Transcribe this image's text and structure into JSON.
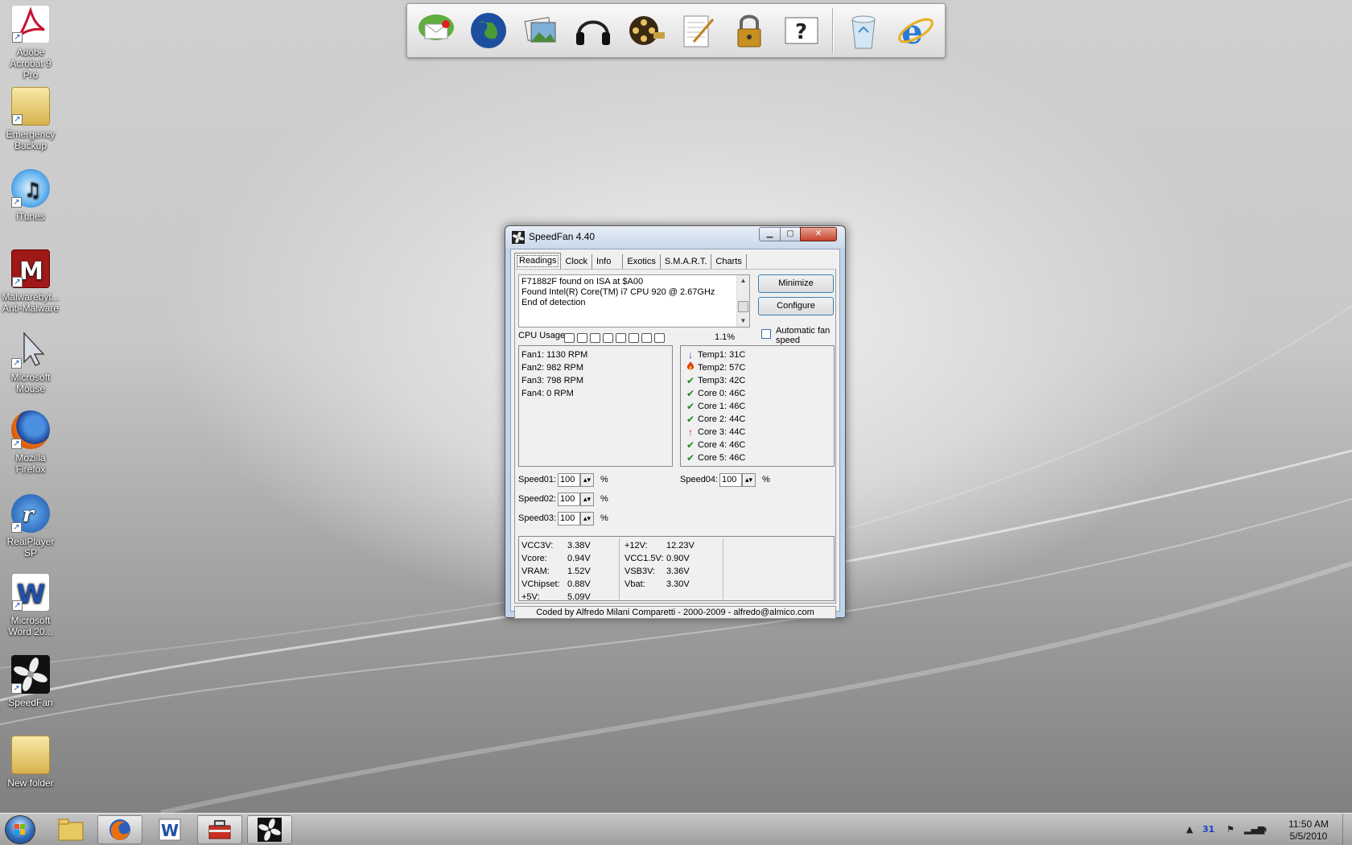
{
  "desktop_icons": [
    {
      "label": "Adobe Acrobat 9 Pro",
      "icon": "adobe-acrobat-icon"
    },
    {
      "label": "Emergency Backup",
      "icon": "folder-icon"
    },
    {
      "label": "iTunes",
      "icon": "itunes-icon"
    },
    {
      "label": "Malwarebyt... Anti-Malware",
      "icon": "malwarebytes-icon"
    },
    {
      "label": "Microsoft Mouse",
      "icon": "mouse-pointer-icon"
    },
    {
      "label": "Mozilla Firefox",
      "icon": "firefox-icon"
    },
    {
      "label": "RealPlayer SP",
      "icon": "realplayer-icon"
    },
    {
      "label": "Microsoft Word 20...",
      "icon": "word-icon"
    },
    {
      "label": "SpeedFan",
      "icon": "speedfan-icon"
    },
    {
      "label": "New folder",
      "icon": "folder-icon"
    }
  ],
  "dock": [
    "mail-icon",
    "globe-icon",
    "photos-icon",
    "headphones-icon",
    "film-reel-icon",
    "notes-icon",
    "lock-icon",
    "help-icon",
    "recycle-bin-icon",
    "internet-explorer-icon"
  ],
  "window": {
    "title": "SpeedFan 4.40",
    "tabs": [
      "Readings",
      "Clock",
      "Info",
      "Exotics",
      "S.M.A.R.T.",
      "Charts"
    ],
    "log": [
      "F71882F found on ISA at $A00",
      "Found Intel(R) Core(TM) i7 CPU 920 @ 2.67GHz",
      "End of detection"
    ],
    "minimize_label": "Minimize",
    "configure_label": "Configure",
    "auto_fan_label": "Automatic fan speed",
    "auto_fan_checked": false,
    "cpu_usage_label": "CPU Usage",
    "cpu_usage_value": "1.1%",
    "fans": [
      "Fan1: 1130 RPM",
      "Fan2: 982 RPM",
      "Fan3: 798 RPM",
      "Fan4: 0 RPM"
    ],
    "temps": [
      {
        "label": "Temp1:",
        "value": "31C",
        "status": "down-arrow-icon",
        "color": "#1a3fd0"
      },
      {
        "label": "Temp2:",
        "value": "57C",
        "status": "flame-icon",
        "color": "#e04010"
      },
      {
        "label": "Temp3:",
        "value": "42C",
        "status": "checkmark-icon",
        "color": "#1c8a1c"
      },
      {
        "label": "Core 0:",
        "value": "46C",
        "status": "checkmark-icon",
        "color": "#1c8a1c"
      },
      {
        "label": "Core 1:",
        "value": "46C",
        "status": "checkmark-icon",
        "color": "#1c8a1c"
      },
      {
        "label": "Core 2:",
        "value": "44C",
        "status": "checkmark-icon",
        "color": "#1c8a1c"
      },
      {
        "label": "Core 3:",
        "value": "44C",
        "status": "up-arrow-icon",
        "color": "#d01010"
      },
      {
        "label": "Core 4:",
        "value": "46C",
        "status": "checkmark-icon",
        "color": "#1c8a1c"
      },
      {
        "label": "Core 5:",
        "value": "46C",
        "status": "checkmark-icon",
        "color": "#1c8a1c"
      }
    ],
    "speeds": [
      {
        "label": "Speed01:",
        "value": "100",
        "unit": "%"
      },
      {
        "label": "Speed02:",
        "value": "100",
        "unit": "%"
      },
      {
        "label": "Speed03:",
        "value": "100",
        "unit": "%"
      },
      {
        "label": "Speed04:",
        "value": "100",
        "unit": "%"
      }
    ],
    "voltages_left": [
      {
        "label": "VCC3V:",
        "value": "3.38V"
      },
      {
        "label": "Vcore:",
        "value": "0.94V"
      },
      {
        "label": "VRAM:",
        "value": "1.52V"
      },
      {
        "label": "VChipset:",
        "value": "0.88V"
      },
      {
        "label": "+5V:",
        "value": "5.09V"
      }
    ],
    "voltages_right": [
      {
        "label": "+12V:",
        "value": "12.23V"
      },
      {
        "label": "VCC1.5V:",
        "value": "0.90V"
      },
      {
        "label": "VSB3V:",
        "value": "3.36V"
      },
      {
        "label": "Vbat:",
        "value": "3.30V"
      }
    ],
    "footer": "Coded by Alfredo Milani Comparetti - 2000-2009 - alfredo@almico.com"
  },
  "taskbar": {
    "items": [
      "start-orb-icon",
      "file-explorer-icon",
      "firefox-icon",
      "word-icon",
      "toolbox-icon",
      "speedfan-icon"
    ],
    "clock_time": "11:50 AM",
    "clock_date": "5/5/2010",
    "tray_badge": "31"
  }
}
